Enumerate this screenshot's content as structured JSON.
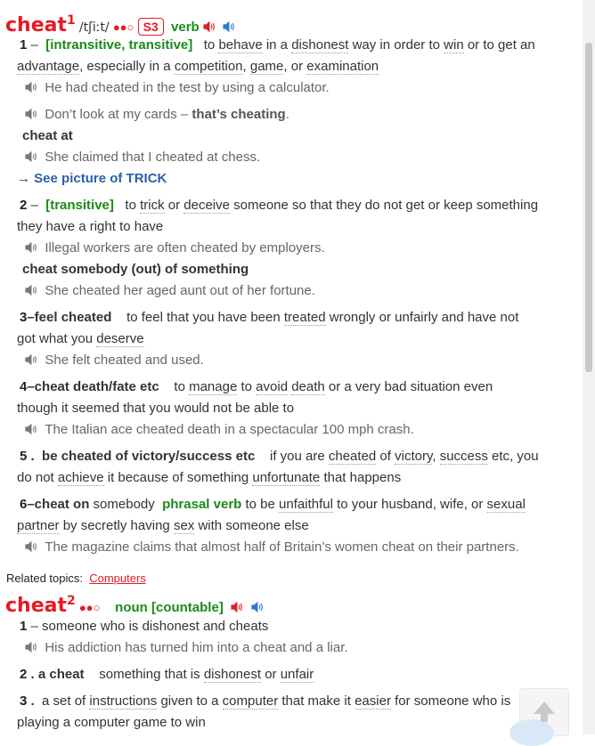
{
  "entry1": {
    "headword": "cheat",
    "homnum": "1",
    "pron": "/tʃiːt/",
    "freq": "●●○",
    "s3": "S3",
    "pos": "verb",
    "senses": {
      "s1": {
        "num": "1",
        "dash": "–",
        "gram": "[intransitive, transitive]",
        "def": {
          "to": "to",
          "behave": "behave",
          "in_a": "in a",
          "dishonest": "dishonest",
          "way_in_order_to": "way in order to",
          "win": "win",
          "or_to_get_an": "or to get an",
          "advantage": "advantage",
          "especially": ", especially in a",
          "competition": "competition",
          "comma": ",",
          "game": "game",
          "or": ", or",
          "examination": "examination"
        },
        "examples": [
          "He had cheated in the test by using a calculator."
        ],
        "example2a": "Don’t look at my cards – ",
        "example2b": "that’s cheating",
        "example2c": ".",
        "colloc": "cheat at",
        "colloc_example": "She claimed that I cheated at chess.",
        "see_arrow": "→",
        "see_label": "See picture of TRICK"
      },
      "s2": {
        "num": "2",
        "dash": "–",
        "gram": "[transitive]",
        "def_a": "to",
        "trick": "trick",
        "or": "or",
        "deceive": "deceive",
        "def_b": "someone so that they do not get or keep something",
        "def_c": "they have a right to have",
        "example": "Illegal workers are often cheated by employers.",
        "colloc": "cheat somebody (out) of something",
        "colloc_example": "She cheated her aged aunt out of her fortune."
      },
      "s3": {
        "num": "3",
        "lead": "–feel cheated",
        "def_a": "to feel that you have been",
        "treated": "treated",
        "def_b": "wrongly or unfairly and have not",
        "def_c": "got what you",
        "deserve": "deserve",
        "example": "She felt cheated and used."
      },
      "s4": {
        "num": "4",
        "lead": "–cheat death/fate etc",
        "def_a": "to",
        "manage": "manage",
        "to": "to",
        "avoid": "avoid",
        "death": "death",
        "def_b": "or a very bad situation even",
        "def_c": "though it seemed that you would not be able to",
        "example": "The Italian ace cheated death in a spectacular 100 mph crash."
      },
      "s5": {
        "num": "5",
        "dot": ".",
        "lead": "be cheated of victory/success etc",
        "def_a": "if you are",
        "cheated": "cheated",
        "of": "of",
        "victory": "victory",
        "comma": ",",
        "success": "success",
        "etc_you": "etc, you",
        "def_b": "do not",
        "achieve": "achieve",
        "def_c": "it because of something",
        "unfortunate": "unfortunate",
        "def_d": "that happens"
      },
      "s6": {
        "num": "6",
        "lead": "–cheat on",
        "somebody": "somebody",
        "phrasal": "phrasal verb",
        "def_a": "to be",
        "unfaithful": "unfaithful",
        "def_b": "to your husband, wife, or",
        "sexual": "sexual",
        "partner": "partner",
        "def_c": "by secretly having",
        "sex": "sex",
        "def_d": "with someone else",
        "example": "The magazine claims that almost half of Britain’s women cheat on their partners."
      }
    }
  },
  "related": {
    "label": "Related topics:",
    "topic": "Computers"
  },
  "entry2": {
    "headword": "cheat",
    "homnum": "2",
    "freq": "●●○",
    "pos": "noun",
    "gram": "[countable]",
    "s1": {
      "num": "1",
      "dash": "–",
      "def": "someone who is dishonest and cheats",
      "example": "His addiction has turned him into a cheat and a liar."
    },
    "s2": {
      "num": "2",
      "dot": ".",
      "lead": "a cheat",
      "def_a": "something that is",
      "dishonest": "dishonest",
      "or": "or",
      "unfair": "unfair"
    },
    "s3": {
      "num": "3",
      "dot": ".",
      "def_a": "a set of",
      "instructions": "instructions",
      "def_b": "given to a",
      "computer": "computer",
      "def_c": "that make it",
      "easier": "easier",
      "def_d": "for someone who is",
      "def_e": "playing a computer game to win"
    }
  },
  "colors": {
    "headword": "#e41b24",
    "pos": "#1a8a1a",
    "link": "#2b5fa8",
    "speaker_red": "#e41b24",
    "speaker_blue": "#2b7bd4"
  },
  "icons": [
    "speaker-red-icon",
    "speaker-blue-icon",
    "speaker-gray-icon",
    "scroll-to-top-icon"
  ]
}
